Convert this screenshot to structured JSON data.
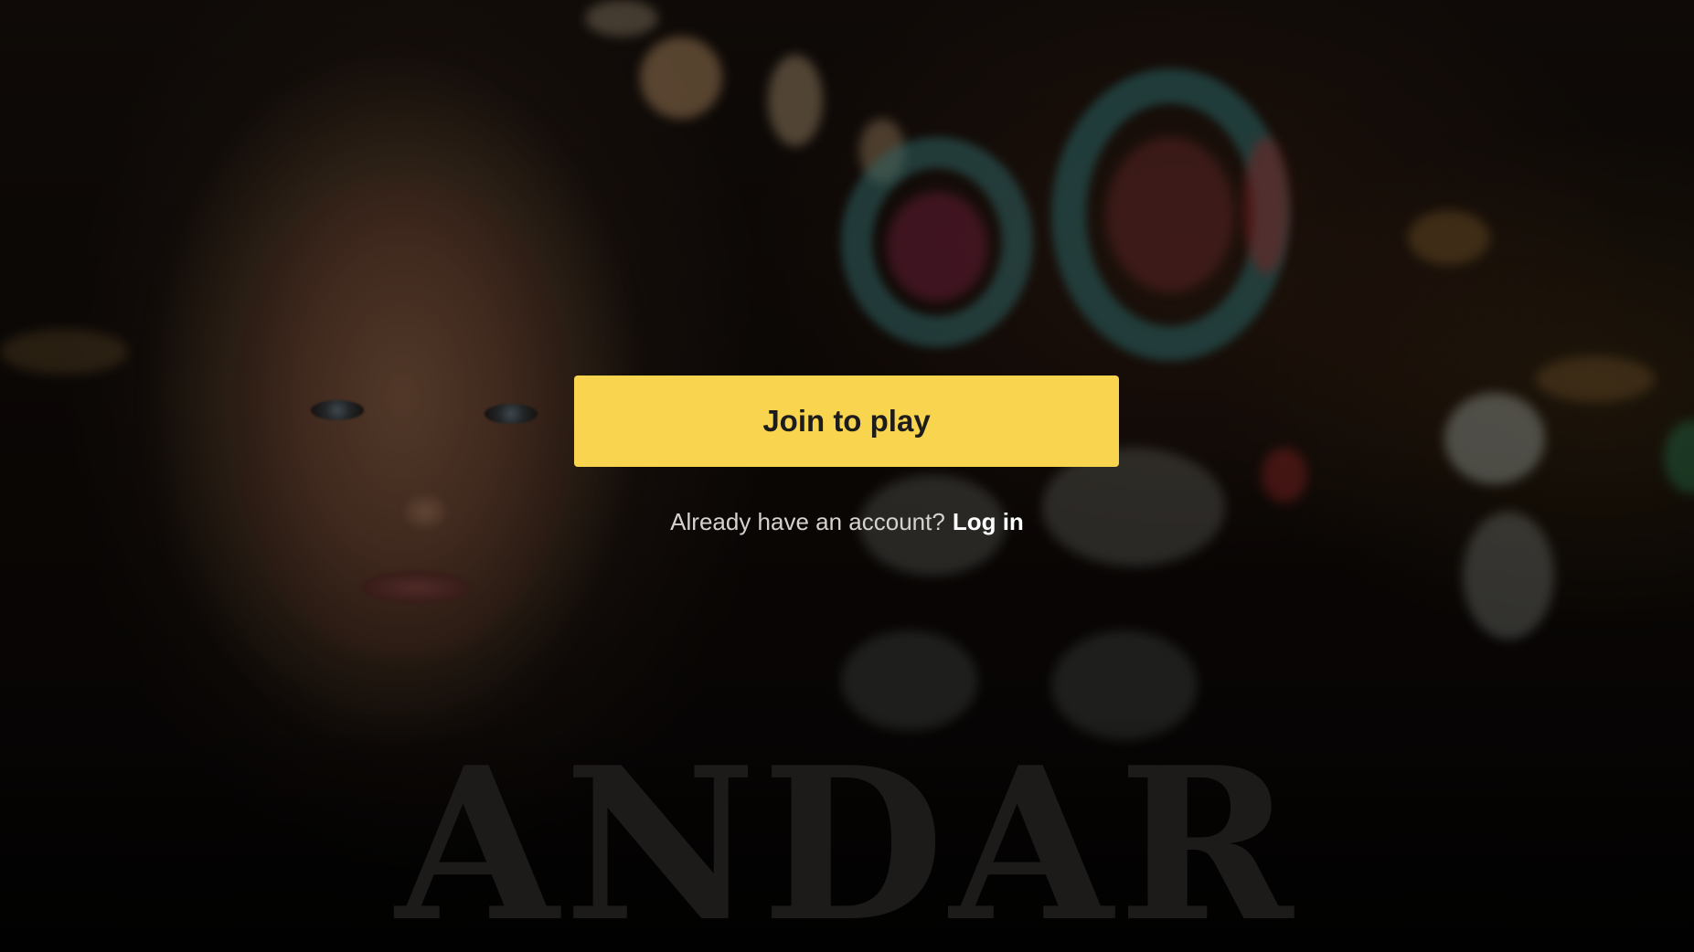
{
  "hero": {
    "join_button_label": "Join to play",
    "login_prompt": "Already have an account?",
    "login_link_label": "Log in",
    "brand_word": "ANDAR"
  },
  "colors": {
    "cta_background": "#f9d44f",
    "cta_text": "#1c1c1c",
    "prompt_text": "#d6d2ce",
    "link_text": "#ffffff"
  }
}
